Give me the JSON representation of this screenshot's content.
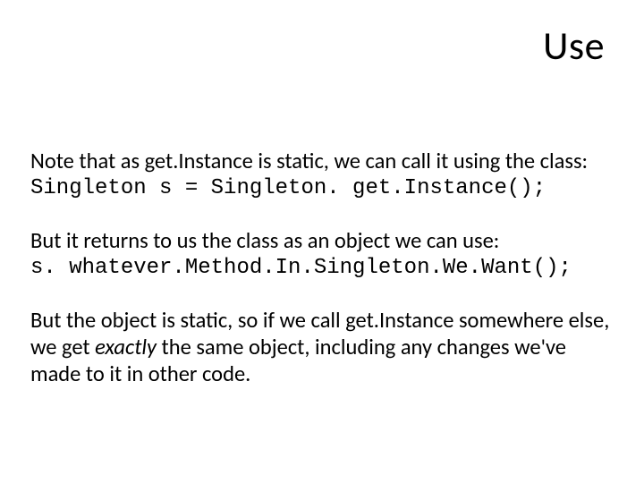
{
  "title": "Use",
  "paragraphs": [
    {
      "kind": "text",
      "text": "Note that as get.Instance is static, we can call it using the class:"
    },
    {
      "kind": "code",
      "text": "Singleton s = Singleton. get.Instance();"
    },
    {
      "kind": "text",
      "text": "But it returns to us the class as an object we can use:"
    },
    {
      "kind": "code",
      "text": "s. whatever.Method.In.Singleton.We.Want();"
    },
    {
      "kind": "mixed",
      "runs": [
        "But the object is static, so if we call get.Instance somewhere else, we get ",
        "exactly ",
        "the same object, including any changes we've made to it in other code."
      ]
    }
  ]
}
